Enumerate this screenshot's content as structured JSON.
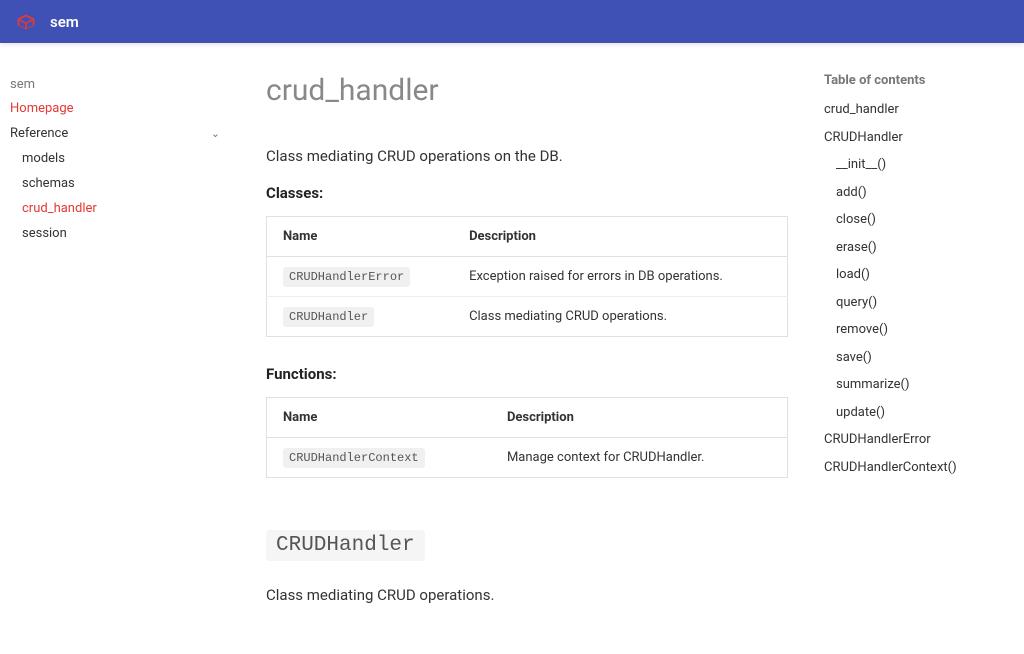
{
  "header": {
    "title": "sem"
  },
  "nav": {
    "title": "sem",
    "homepage": "Homepage",
    "reference": "Reference",
    "models": "models",
    "schemas": "schemas",
    "crud_handler": "crud_handler",
    "session": "session"
  },
  "page": {
    "title": "crud_handler",
    "intro": "Class mediating CRUD operations on the DB.",
    "classes_heading": "Classes:",
    "functions_heading": "Functions:",
    "th_name": "Name",
    "th_description": "Description",
    "classes": [
      {
        "name": "CRUDHandlerError",
        "desc": "Exception raised for errors in DB operations."
      },
      {
        "name": "CRUDHandler",
        "desc": "Class mediating CRUD operations."
      }
    ],
    "functions": [
      {
        "name": "CRUDHandlerContext",
        "desc": "Manage context for CRUDHandler."
      }
    ],
    "section2_heading": "CRUDHandler",
    "section2_intro": "Class mediating CRUD operations."
  },
  "toc": {
    "title": "Table of contents",
    "items": [
      "crud_handler",
      "CRUDHandler",
      "__init__()",
      "add()",
      "close()",
      "erase()",
      "load()",
      "query()",
      "remove()",
      "save()",
      "summarize()",
      "update()",
      "CRUDHandlerError",
      "CRUDHandlerContext()"
    ]
  }
}
